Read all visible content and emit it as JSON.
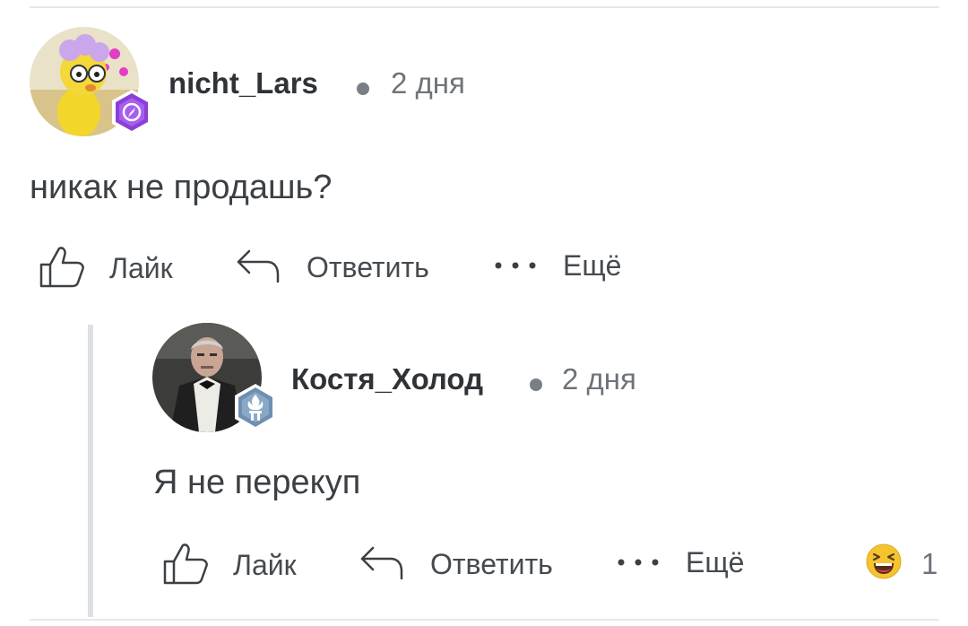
{
  "comments": [
    {
      "username": "nicht_Lars",
      "time": "2 дня",
      "text": "никак не продашь?",
      "actions": {
        "like": "Лайк",
        "reply": "Ответить",
        "more": "Ещё"
      }
    },
    {
      "username": "Костя_Холод",
      "time": "2 дня",
      "text": "Я не перекуп",
      "actions": {
        "like": "Лайк",
        "reply": "Ответить",
        "more": "Ещё"
      },
      "reaction": {
        "emoji": "laughing-emoji",
        "count": "1"
      }
    }
  ],
  "colors": {
    "badge_purple": "#8a3fd6",
    "badge_steel": "#6f8fb0",
    "reaction_yellow": "#f4c430",
    "thread_line": "#dce0e5"
  }
}
